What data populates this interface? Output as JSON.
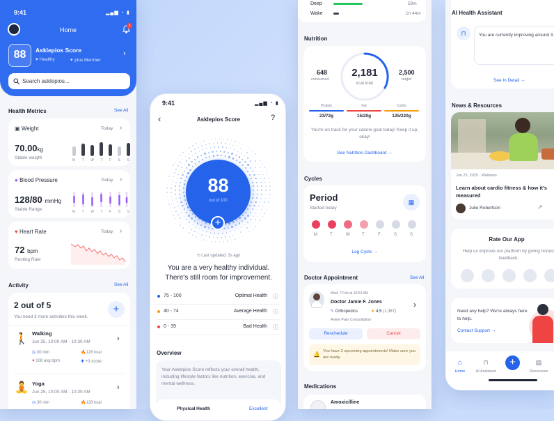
{
  "p1": {
    "time": "9:41",
    "title": "Home",
    "notif_count": "3",
    "score": "88",
    "score_title": "Asklepios Score",
    "healthy": "Healthy",
    "member": "plus Member",
    "search_placeholder": "Search asklepios...",
    "metrics_title": "Health Metrics",
    "see_all": "See All",
    "weight": {
      "label": "Weight",
      "when": "Today",
      "value": "70.00",
      "unit": "kg",
      "status": "Stable weight"
    },
    "bp": {
      "label": "Blood Pressure",
      "when": "Today",
      "value": "128/80",
      "unit": "mmHg",
      "status": "Stable Range"
    },
    "hr": {
      "label": "Heart Rate",
      "when": "Today",
      "value": "72",
      "unit": "bpm",
      "status": "Resting Rate"
    },
    "days": [
      "M",
      "T",
      "W",
      "T",
      "F",
      "S",
      "S"
    ],
    "activity_title": "Activity",
    "activity_see_all": "See All",
    "activity_count": "2 out of 5",
    "activity_need": "You need 3 more activities this week.",
    "walking": {
      "title": "Walking",
      "time": "Jun 25, 10:00 AM - 10:30 AM",
      "min": "30 min",
      "kcal": "128 kcal",
      "bpm": "108 avg bpm",
      "score": "+3 score"
    },
    "yoga": {
      "title": "Yoga",
      "time": "Jun 25, 10:00 AM - 10:30 AM",
      "min": "30 min",
      "kcal": "128 kcal"
    }
  },
  "p2": {
    "time": "9:41",
    "title": "Asklepios Score",
    "help": "?",
    "score": "88",
    "out_of": "out of 100",
    "updated": "Last updated: 3s ago",
    "message": "You are a very healthy individual. There's still room for improvement.",
    "legend": [
      {
        "range": "75 - 100",
        "label": "Optimal Health",
        "color": "#2563eb"
      },
      {
        "range": "40 - 74",
        "label": "Average Health",
        "color": "#f59e0b"
      },
      {
        "range": "0 - 39",
        "label": "Bad Health",
        "color": "#ef4444"
      }
    ],
    "overview_title": "Overview",
    "overview_text": "Your Asklepios Score reflects your overall health, including lifestyle factors like nutrition, exercise, and mental wellness.",
    "phys_label": "Physical Health",
    "phys_value": "Excellent"
  },
  "p3": {
    "deep": "Deep",
    "deep_val": "59m",
    "wake": "Wake",
    "wake_val": "1h 44m",
    "nutrition_title": "Nutrition",
    "consumed": "648",
    "consumed_label": "consumed",
    "kcal": "2,181",
    "kcal_label": "kcal total",
    "target": "2,500",
    "target_label": "target",
    "macros": [
      {
        "name": "Protein",
        "val": "23/72g",
        "color": "#2563eb"
      },
      {
        "name": "Fat",
        "val": "15/20g",
        "color": "#ef4444"
      },
      {
        "name": "Carbs",
        "val": "125/220g",
        "color": "#f59e0b"
      }
    ],
    "nutrition_msg": "You're on track for your calorie goal today! Keep it up, okay!",
    "nutrition_link": "See Nutrition Dashboard",
    "cycles_title": "Cycles",
    "period": "Period",
    "period_sub": "Started today",
    "cycle_days": [
      "M",
      "T",
      "W",
      "T",
      "F",
      "S",
      "S"
    ],
    "cycle_colors": [
      "#e8415f",
      "#e8415f",
      "#ef6b82",
      "#f3a0ad",
      "#d6dae3",
      "#d6dae3",
      "#d6dae3"
    ],
    "log_cycle": "Log Cycle",
    "doctor_title": "Doctor Appointment",
    "doctor_see_all": "See All",
    "appt_time": "Wed, 7 Feb at 10:53 AM",
    "doctor_name": "Doctor Jamie F. Jones",
    "specialty": "Orthopedics",
    "rating": "4.5",
    "reviews": "(1,387)",
    "consult": "Ankle Pain Consultation",
    "reschedule": "Reschedule",
    "cancel": "Cancel",
    "upcoming": "You have 2 upcoming appointments! Make sure you are ready.",
    "medications_title": "Medications",
    "med_name": "Amoxicilline"
  },
  "p4": {
    "assistant_title": "AI Health Assistant",
    "assistant_msg": "You are currently improving around 3.5% from last month? Would you like a few health tips and reasons?",
    "see_detail": "See In Detail",
    "news_title": "News & Resources",
    "news_date": "Jun 23, 2025",
    "news_cat": "Wellness",
    "news_headline": "Learn about cardio fitness & how it's measured",
    "author": "Julie Robertson",
    "rate_title": "Rate Our App",
    "rate_text": "Help us improve our platform by giving honest feedback.",
    "help_text": "Need any help? We're always here to help.",
    "contact": "Contact Support",
    "nav": [
      {
        "label": "Home",
        "icon": "home-icon"
      },
      {
        "label": "AI Assistant",
        "icon": "ai-icon"
      },
      {
        "label": "",
        "icon": "plus-icon"
      },
      {
        "label": "Resources",
        "icon": "resources-icon"
      }
    ]
  }
}
